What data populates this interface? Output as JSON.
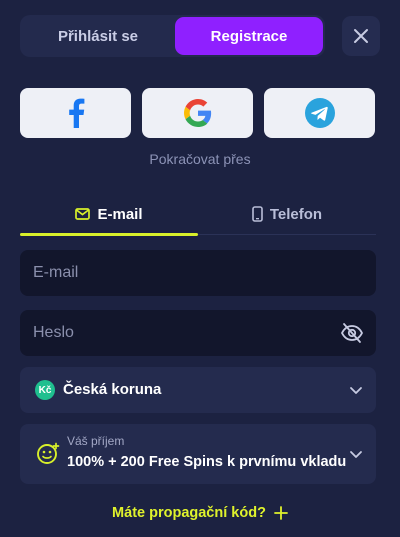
{
  "auth": {
    "login_label": "Přihlásit se",
    "register_label": "Registrace"
  },
  "social": {
    "continue_label": "Pokračovat přes",
    "providers": [
      "facebook",
      "google",
      "telegram"
    ]
  },
  "method_tabs": {
    "email_label": "E-mail",
    "phone_label": "Telefon",
    "active": "email"
  },
  "form": {
    "email_placeholder": "E-mail",
    "email_value": "",
    "password_placeholder": "Heslo",
    "password_value": ""
  },
  "currency": {
    "badge": "Kč",
    "label": "Česká koruna"
  },
  "bonus": {
    "caption": "Váš příjem",
    "value": "100% + 200 Free Spins k prvnímu vkladu"
  },
  "promo": {
    "label": "Máte propagační kód?"
  },
  "colors": {
    "background": "#1c2241",
    "accent_purple": "#8f20ff",
    "accent_lime": "#d8f02a",
    "input_bg": "#12162c",
    "select_bg": "#242b4e"
  },
  "icons": [
    "close-icon",
    "facebook-icon",
    "google-icon",
    "telegram-icon",
    "mail-icon",
    "phone-icon",
    "eye-off-icon",
    "chevron-down-icon",
    "smile-icon",
    "plus-icon"
  ]
}
